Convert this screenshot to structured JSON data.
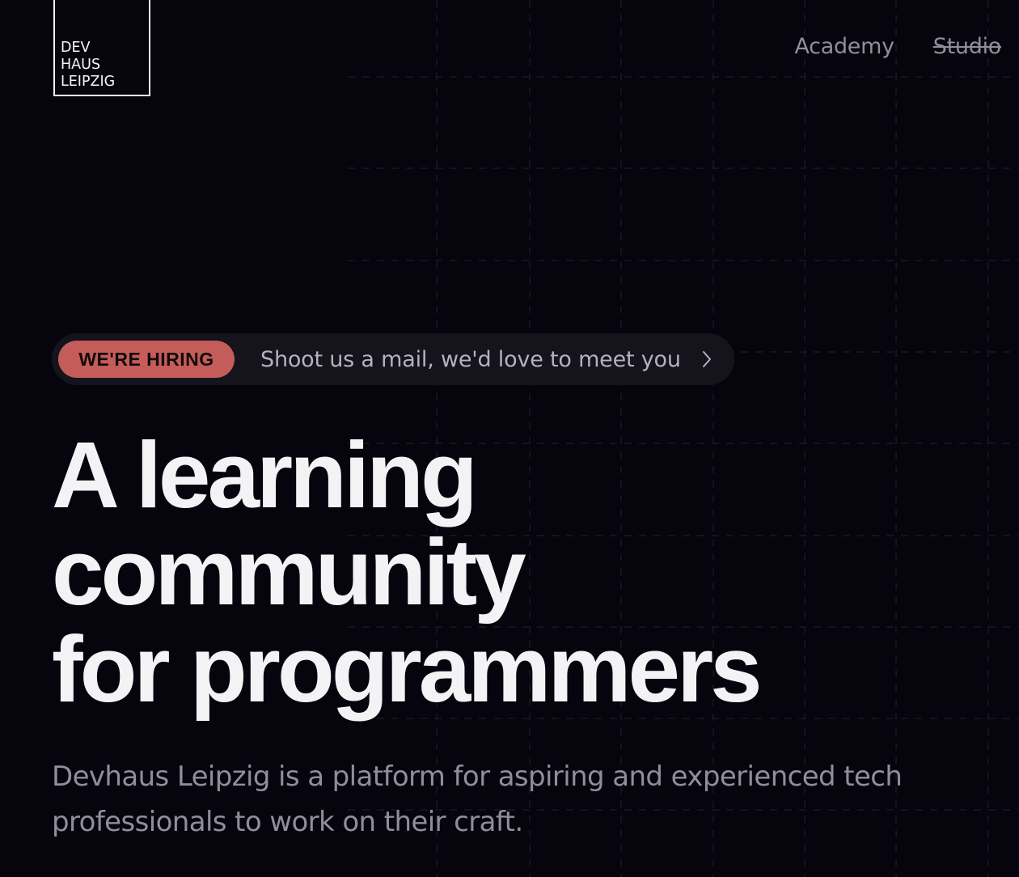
{
  "logo": {
    "lines": [
      "DEV",
      "HAUS",
      "LEIPZIG"
    ]
  },
  "nav": {
    "academy": "Academy",
    "studio": "Studio"
  },
  "announcement": {
    "badge": "WE'RE HIRING",
    "text": "Shoot us a mail, we'd love to meet you",
    "icon": "chevron-right-icon"
  },
  "hero": {
    "headline_lines": [
      "A learning",
      "community",
      "for programmers"
    ],
    "description": "Devhaus Leipzig is a platform for aspiring and experienced tech professionals to work on their craft."
  },
  "colors": {
    "background": "#06050e",
    "accent": "#c45c59",
    "muted_text": "#8f8e99",
    "headline": "#f3f3f6"
  }
}
